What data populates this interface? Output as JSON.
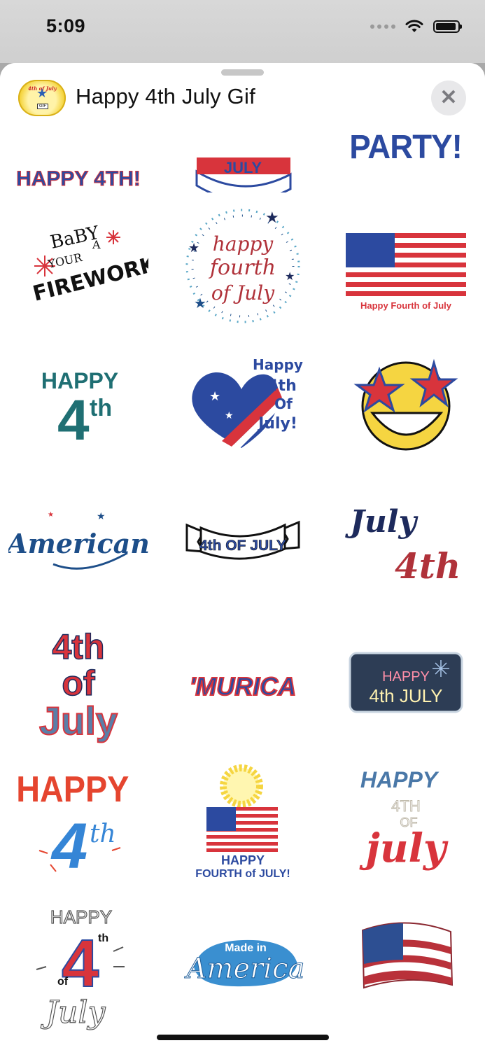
{
  "status": {
    "time": "5:09"
  },
  "header": {
    "title": "Happy 4th July Gif",
    "app_icon_text": "4th of July",
    "app_icon_badge": "GIF",
    "close_glyph": "✕"
  },
  "stickers": {
    "r0c0": "HAPPY 4TH!",
    "r0c1": "JULY",
    "r0c2": "PARTY!",
    "r1c0": [
      "BaBY",
      "YOUR",
      "A",
      "FIREWORK"
    ],
    "r1c1": [
      "happy",
      "fourth",
      "of July"
    ],
    "r1c2": "Happy Fourth of July",
    "r2c0": [
      "HAPPY",
      "4",
      "th"
    ],
    "r2c1": [
      "Happy",
      "4th",
      "Of",
      "July!"
    ],
    "r3c0": "American",
    "r3c1": "4th OF JULY",
    "r3c2": [
      "July",
      "4th"
    ],
    "r4c0": [
      "4th",
      "of",
      "July"
    ],
    "r4c1": "'MURICA",
    "r4c2": [
      "HAPPY",
      "4th JULY"
    ],
    "r5c0": [
      "HAPPY",
      "4",
      "th"
    ],
    "r5c1": [
      "HAPPY",
      "FOURTH of JULY!"
    ],
    "r5c2": [
      "HAPPY",
      "4TH",
      "OF",
      "july"
    ],
    "r6c0": [
      "HAPPY",
      "4",
      "th",
      "of",
      "July"
    ],
    "r6c1": [
      "Made in",
      "America"
    ]
  },
  "colors": {
    "red": "#d8343c",
    "blue": "#2c4aa0",
    "navy": "#1d2a5c",
    "teal": "#1f6f73",
    "gold": "#f5d541"
  }
}
